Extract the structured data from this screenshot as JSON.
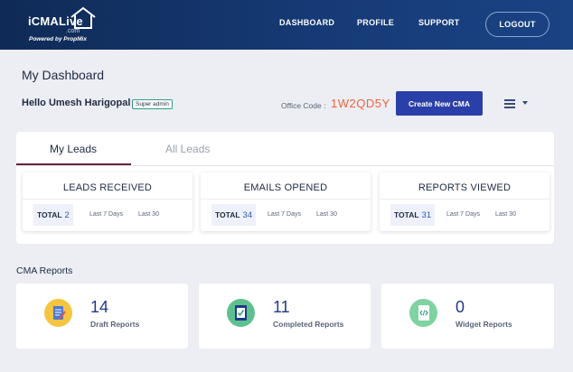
{
  "header": {
    "logo": {
      "main": "iCMALive",
      "com": ".com",
      "powered": "Powered by PropMix"
    },
    "nav": [
      "DASHBOARD",
      "PROFILE",
      "SUPPORT"
    ],
    "logout_label": "LOGOUT"
  },
  "dashboard": {
    "title": "My Dashboard",
    "greeting": "Hello Umesh Harigopal",
    "role_badge": "Super admin",
    "office_label": "Office Code :",
    "office_code": "1W2QD5Y",
    "create_button": "Create New CMA",
    "menu_icon": "hamburger-icon"
  },
  "leads": {
    "tabs": [
      {
        "label": "My Leads",
        "active": true
      },
      {
        "label": "All Leads",
        "active": false
      }
    ],
    "stats": [
      {
        "title": "LEADS RECEIVED",
        "total_label": "TOTAL",
        "total": "2",
        "opt1": "Last 7 Days",
        "opt2": "Last 30"
      },
      {
        "title": "EMAILS OPENED",
        "total_label": "TOTAL",
        "total": "34",
        "opt1": "Last 7 Days",
        "opt2": "Last 30"
      },
      {
        "title": "REPORTS VIEWED",
        "total_label": "TOTAL",
        "total": "31",
        "opt1": "Last 7 Days",
        "opt2": "Last 30"
      }
    ]
  },
  "reports": {
    "section_title": "CMA Reports",
    "items": [
      {
        "count": "14",
        "label": "Draft Reports",
        "icon": "draft-report-icon",
        "icon_color": "#f5c542"
      },
      {
        "count": "11",
        "label": "Completed Reports",
        "icon": "completed-report-icon",
        "icon_color": "#5cc08f"
      },
      {
        "count": "0",
        "label": "Widget Reports",
        "icon": "widget-report-icon",
        "icon_color": "#7ed3a0"
      }
    ]
  },
  "colors": {
    "header": "#163a75",
    "accent": "#2b3fa8",
    "office_code": "#f0643c",
    "tab_underline": "#6a1f3f"
  }
}
